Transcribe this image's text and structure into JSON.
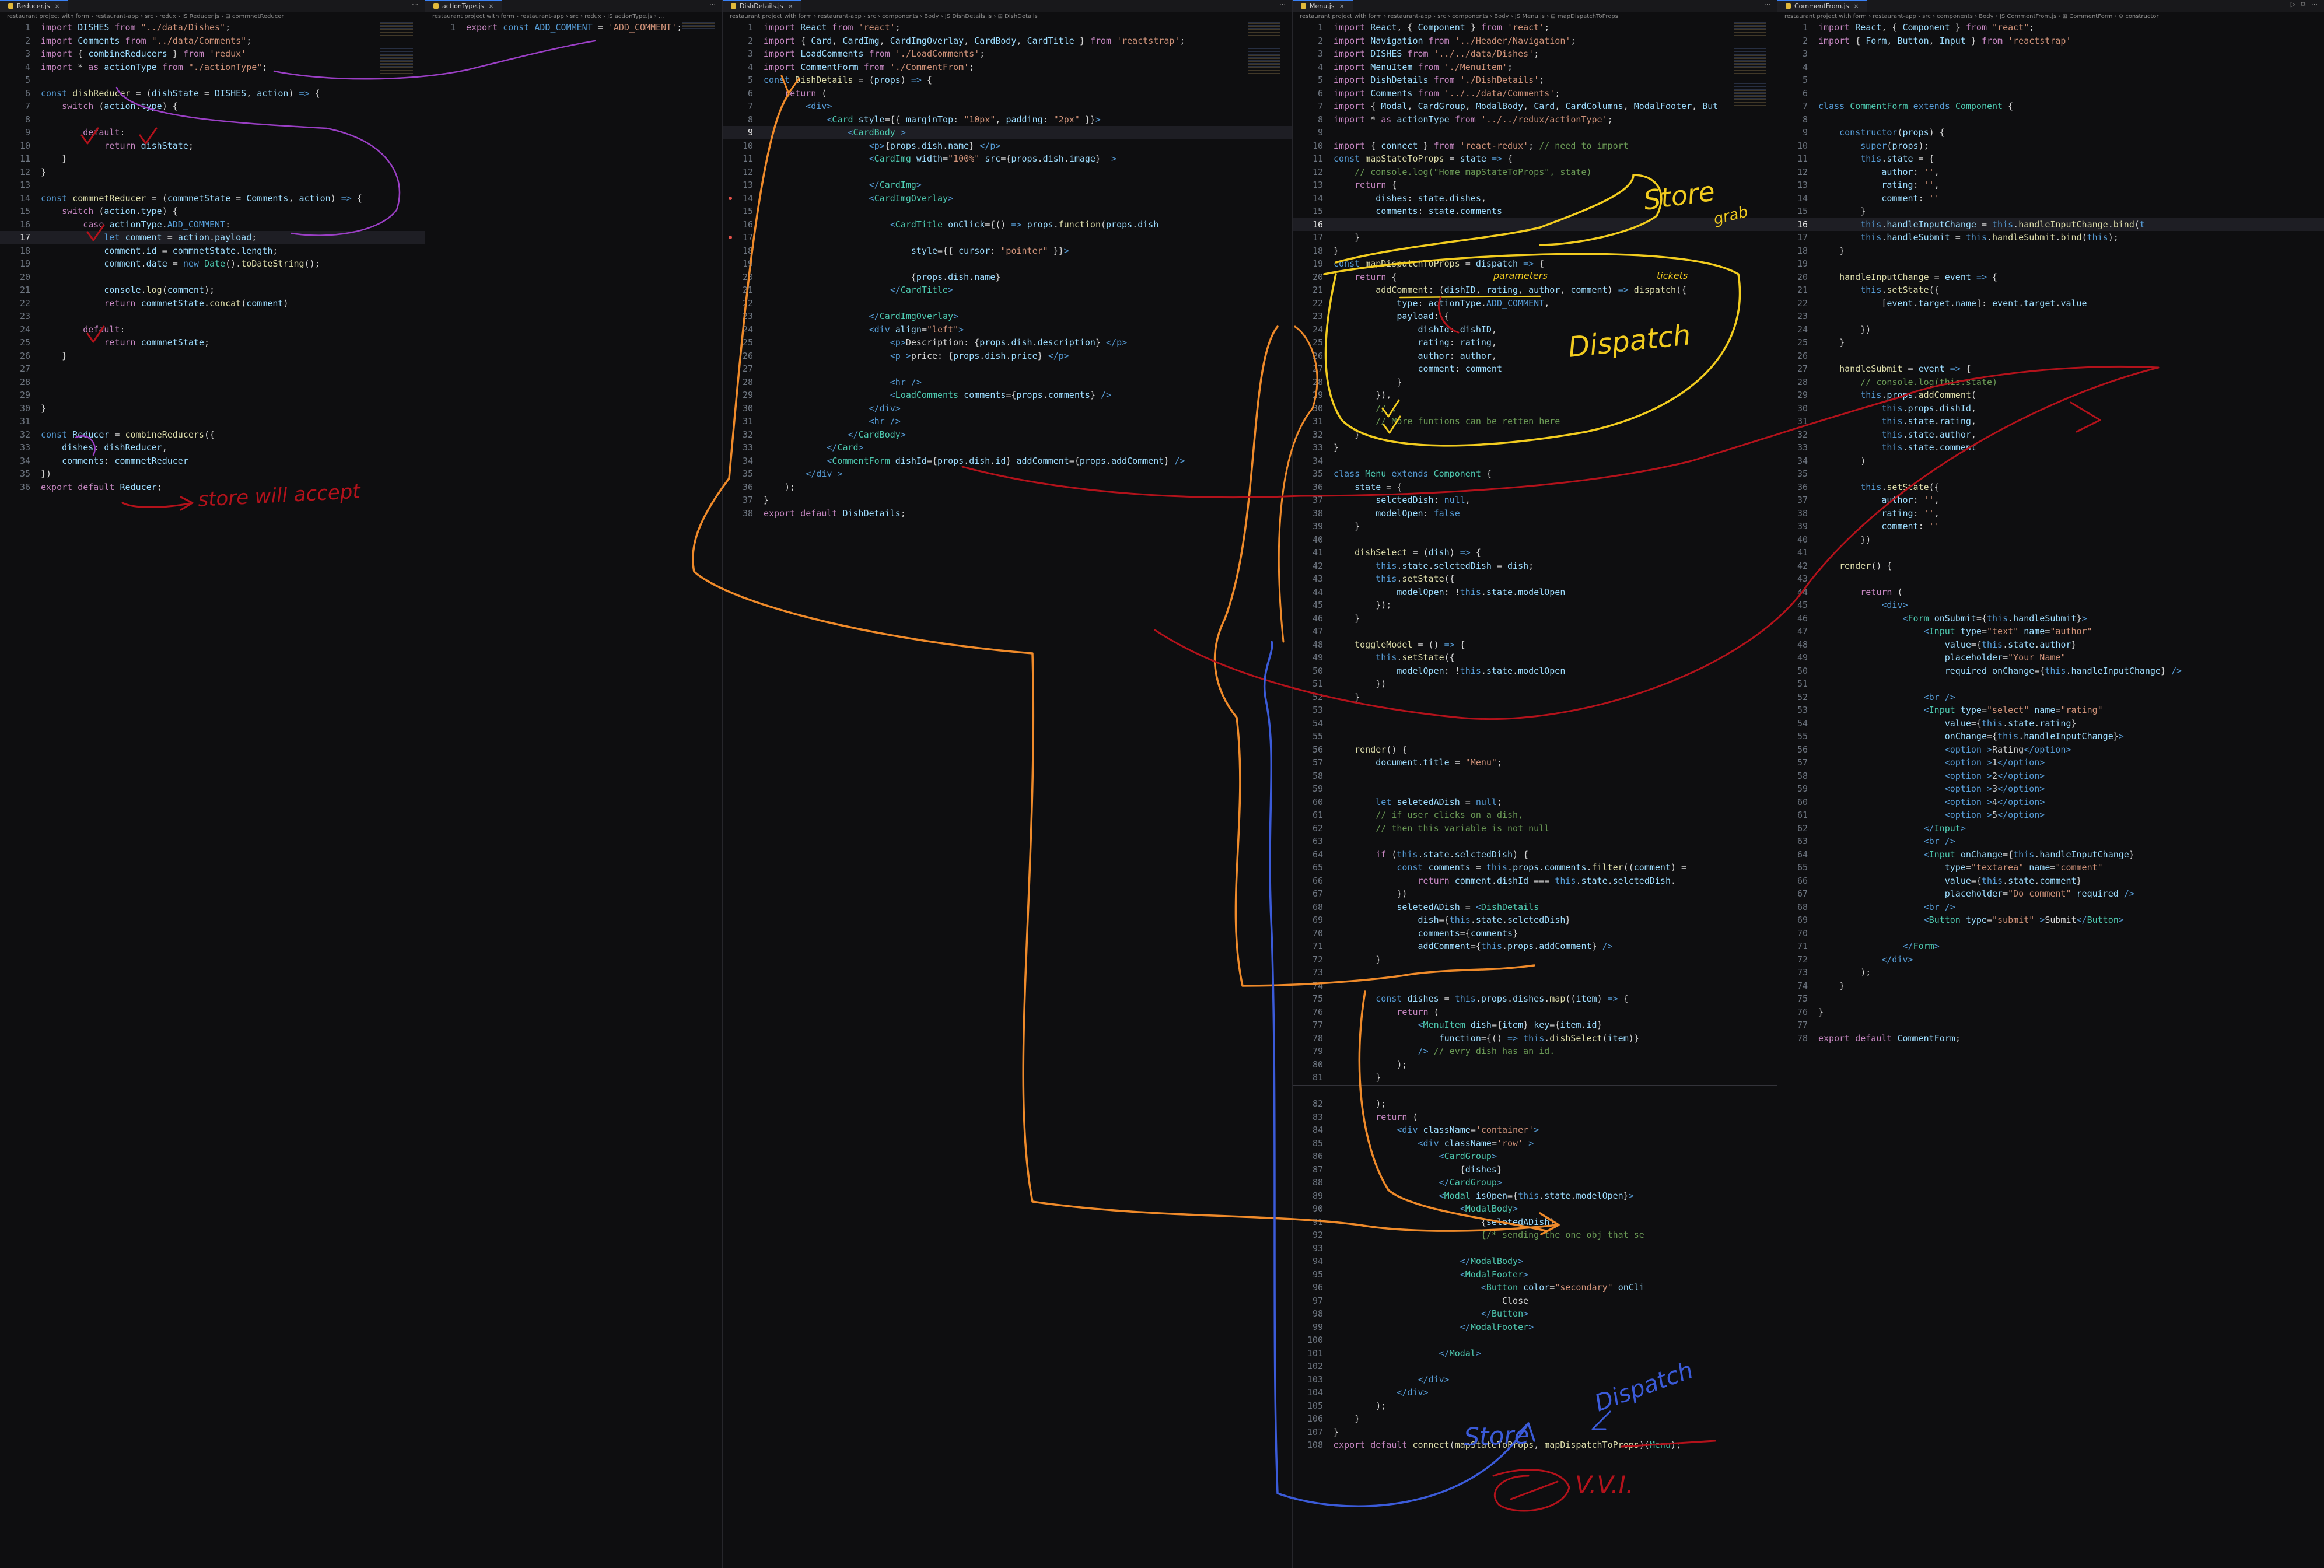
{
  "panes": [
    {
      "tab": "Reducer.js",
      "breadcrumb": "restaurant project with form › restaurant-app › src › redux › JS Reducer.js › ⊞ commnetReducer",
      "lines": [
        "import DISHES from \"../data/Dishes\";",
        "import Comments from \"../data/Comments\";",
        "import { combineReducers } from 'redux'",
        "import * as actionType from \"./actionType\";",
        "",
        "const dishReducer = (dishState = DISHES, action) => {",
        "    switch (action.type) {",
        "",
        "        default:",
        "            return dishState;",
        "    }",
        "}",
        "",
        "const commnetReducer = (commnetState = Comments, action) => {",
        "    switch (action.type) {",
        "        case actionType.ADD_COMMENT:",
        "            let comment = action.payload;",
        "            comment.id = commnetState.length;",
        "            comment.date = new Date().toDateString();",
        "",
        "            console.log(comment);",
        "            return commnetState.concat(comment)",
        "",
        "        default:",
        "            return commnetState;",
        "    }",
        "",
        "",
        "",
        "}",
        "",
        "const Reducer = combineReducers({",
        "    dishes: dishReducer,",
        "    comments: commnetReducer",
        "})",
        "export default Reducer;"
      ]
    },
    {
      "tab": "actionType.js",
      "breadcrumb": "restaurant project with form › restaurant-app › src › redux › JS actionType.js › ...",
      "lines": [
        "export const ADD_COMMENT = 'ADD_COMMENT';"
      ]
    },
    {
      "tab": "DishDetails.js",
      "breadcrumb": "restaurant project with form › restaurant-app › src › components › Body › JS DishDetails.js › ⊞ DishDetails",
      "lines": [
        "import React from 'react';",
        "import { Card, CardImg, CardImgOverlay, CardBody, CardTitle } from 'reactstrap';",
        "import LoadComments from './LoadComments';",
        "import CommentForm from './CommentFrom';",
        "const DishDetails = (props) => {",
        "    return (",
        "        <div>",
        "            <Card style={{ marginTop: \"10px\", padding: \"2px\" }}>",
        "                <CardBody >",
        "                    <p>{props.dish.name} </p>",
        "                    <CardImg width=\"100%\" src={props.dish.image}  >",
        "",
        "                    </CardImg>",
        "                    <CardImgOverlay>",
        "",
        "                        <CardTitle onClick={() => props.function(props.dish",
        "",
        "                            style={{ cursor: \"pointer\" }}>",
        "",
        "                            {props.dish.name}",
        "                        </CardTitle>",
        "",
        "                    </CardImgOverlay>",
        "                    <div align=\"left\">",
        "                        <p>Description: {props.dish.description} </p>",
        "                        <p >price: {props.dish.price} </p>",
        "",
        "                        <hr />",
        "                        <LoadComments comments={props.comments} />",
        "                    </div>",
        "                    <hr />",
        "                </CardBody>",
        "            </Card>",
        "            <CommentForm dishId={props.dish.id} addComment={props.addComment} />",
        "        </div >",
        "    );",
        "}",
        "export default DishDetails;"
      ]
    },
    {
      "tab": "Menu.js",
      "breadcrumb": "restaurant project with form › restaurant-app › src › components › Body › JS Menu.js › ⊞ mapDispatchToProps",
      "lines": [
        "import React, { Component } from 'react';",
        "import Navigation from '../Header/Navigation';",
        "import DISHES from '../../data/Dishes';",
        "import MenuItem from './MenuItem';",
        "import DishDetails from './DishDetails';",
        "import Comments from '../../data/Comments';",
        "import { Modal, CardGroup, ModalBody, Card, CardColumns, ModalFooter, But",
        "import * as actionType from '../../redux/actionType';",
        "",
        "import { connect } from 'react-redux'; // need to import",
        "const mapStateToProps = state => {",
        "    // console.log(\"Home mapStateToProps\", state)",
        "    return {",
        "        dishes: state.dishes,",
        "        comments: state.comments",
        "",
        "    }",
        "}",
        "const mapDispatchToProps = dispatch => {",
        "    return {",
        "        addComment: (dishID, rating, author, comment) => dispatch({",
        "            type: actionType.ADD_COMMENT,",
        "            payload: {",
        "                dishId: dishID,",
        "                rating: rating,",
        "                author: author,",
        "                comment: comment",
        "            }",
        "        }),",
        "        // ,",
        "        // More funtions can be retten here",
        "    }",
        "}",
        "",
        "class Menu extends Component {",
        "    state = {",
        "        selctedDish: null,",
        "        modelOpen: false",
        "    }",
        "",
        "    dishSelect = (dish) => {",
        "        this.state.selctedDish = dish;",
        "        this.setState({",
        "            modelOpen: !this.state.modelOpen",
        "        });",
        "    }",
        "",
        "    toggleModel = () => {",
        "        this.setState({",
        "            modelOpen: !this.state.modelOpen",
        "        })",
        "    }",
        "",
        "",
        "",
        "    render() {",
        "        document.title = \"Menu\";",
        "",
        "",
        "        let seletedADish = null;",
        "        // if user clicks on a dish,",
        "        // then this variable is not null",
        "",
        "        if (this.state.selctedDish) {",
        "            const comments = this.props.comments.filter((comment) =",
        "                return comment.dishId === this.state.selctedDish.",
        "            })",
        "            seletedADish = <DishDetails",
        "                dish={this.state.selctedDish}",
        "                comments={comments}",
        "                addComment={this.props.addComment} />",
        "        }",
        "",
        "",
        "        const dishes = this.props.dishes.map((item) => {",
        "            return (",
        "                <MenuItem dish={item} key={item.id}",
        "                    function={() => this.dishSelect(item)}",
        "                /> // evry dish has an id.",
        "            );",
        "        }",
        "",
        "        );",
        "        return (",
        "            <div className='container'>",
        "                <div className='row' >",
        "                    <CardGroup>",
        "                        {dishes}",
        "                    </CardGroup>",
        "                    <Modal isOpen={this.state.modelOpen}>",
        "                        <ModalBody>",
        "                            {seletedADish}",
        "                            {/* sending the one obj that se",
        "",
        "                        </ModalBody>",
        "                        <ModalFooter>",
        "                            <Button color=\"secondary\" onCli",
        "                                Close",
        "                            </Button>",
        "                        </ModalFooter>",
        "",
        "                    </Modal>",
        "",
        "                </div>",
        "            </div>",
        "        );",
        "    }",
        "}",
        "export default connect(mapStateToProps, mapDispatchToProps)(Menu);"
      ]
    },
    {
      "tab": "CommentFrom.js",
      "breadcrumb": "restaurant project with form › restaurant-app › src › components › Body › JS CommentFrom.js › ⊞ CommentForm › ⊙ constructor",
      "lines": [
        "import React, { Component } from \"react\";",
        "import { Form, Button, Input } from 'reactstrap'",
        "",
        "",
        "",
        "",
        "class CommentForm extends Component {",
        "",
        "    constructor(props) {",
        "        super(props);",
        "        this.state = {",
        "            author: '',",
        "            rating: '',",
        "            comment: ''",
        "        }",
        "        this.handleInputChange = this.handleInputChange.bind(t",
        "        this.handleSubmit = this.handleSubmit.bind(this);",
        "    }",
        "",
        "    handleInputChange = event => {",
        "        this.setState({",
        "            [event.target.name]: event.target.value",
        "",
        "        })",
        "    }",
        "",
        "    handleSubmit = event => {",
        "        // console.log(this.state)",
        "        this.props.addComment(",
        "            this.props.dishId,",
        "            this.state.rating,",
        "            this.state.author,",
        "            this.state.comment",
        "        )",
        "",
        "        this.setState({",
        "            author: '',",
        "            rating: '',",
        "            comment: ''",
        "        })",
        "",
        "    render() {",
        "",
        "        return (",
        "            <div>",
        "                <Form onSubmit={this.handleSubmit}>",
        "                    <Input type=\"text\" name=\"author\"",
        "                        value={this.state.author}",
        "                        placeholder=\"Your Name\"",
        "                        required onChange={this.handleInputChange} />",
        "",
        "                    <br />",
        "                    <Input type=\"select\" name=\"rating\"",
        "                        value={this.state.rating}",
        "                        onChange={this.handleInputChange}>",
        "                        <option >Rating</option>",
        "                        <option >1</option>",
        "                        <option >2</option>",
        "                        <option >3</option>",
        "                        <option >4</option>",
        "                        <option >5</option>",
        "                    </Input>",
        "                    <br />",
        "                    <Input onChange={this.handleInputChange}",
        "                        type=\"textarea\" name=\"comment\"",
        "                        value={this.state.comment}",
        "                        placeholder=\"Do comment\" required />",
        "                    <br />",
        "                    <Button type=\"submit\" >Submit</Button>",
        "",
        "                </Form>",
        "            </div>",
        "        );",
        "    }",
        "",
        "}",
        "",
        "export default CommentForm;"
      ]
    }
  ],
  "annotations": {
    "store_top": "Store",
    "store_top_suffix": "grab",
    "parameters": "parameters",
    "tickets": "tickets",
    "dispatch_mid": "Dispatch",
    "store_will_accept": "store will accept",
    "store_bottom": "Store",
    "dispatch_bottom": "Dispatch",
    "vvi": "V.V.I.",
    "colors": {
      "orange": "#ef8a2a",
      "yellow": "#f2cc1f",
      "red": "#b3121b",
      "blue": "#3b5bd9",
      "purple": "#9b3fc5"
    }
  }
}
